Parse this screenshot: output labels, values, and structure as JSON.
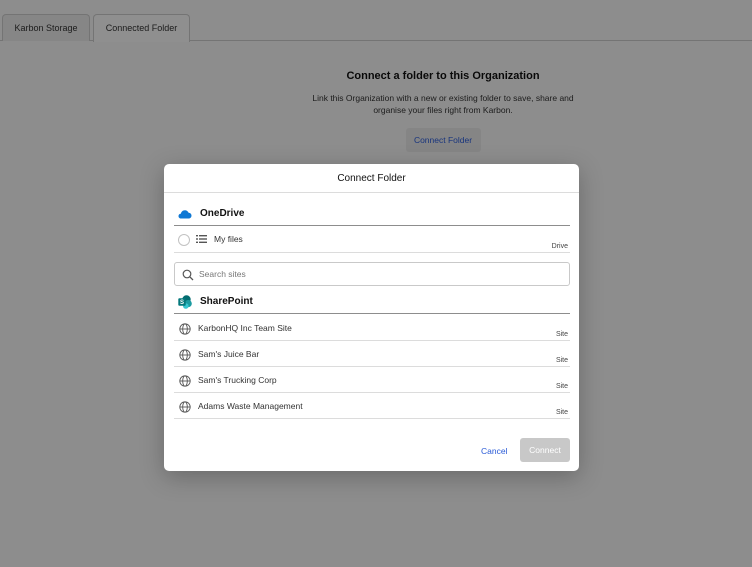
{
  "tabs": [
    {
      "label": "Karbon Storage"
    },
    {
      "label": "Connected Folder"
    }
  ],
  "empty_state": {
    "title": "Connect a folder to this Organization",
    "description_line1": "Link this Organization with a new or existing folder to save, share and",
    "description_line2": "organise your files right from Karbon.",
    "button": "Connect Folder"
  },
  "modal": {
    "title": "Connect Folder",
    "onedrive": {
      "label": "OneDrive",
      "items": [
        {
          "name": "My files",
          "type": "Drive",
          "icon": "list-icon"
        }
      ]
    },
    "search": {
      "placeholder": "Search sites",
      "value": ""
    },
    "sharepoint": {
      "label": "SharePoint",
      "items": [
        {
          "name": "KarbonHQ Inc Team Site",
          "type": "Site",
          "icon": "globe-icon"
        },
        {
          "name": "Sam's Juice Bar",
          "type": "Site",
          "icon": "globe-icon"
        },
        {
          "name": "Sam's Trucking Corp",
          "type": "Site",
          "icon": "globe-icon"
        },
        {
          "name": "Adams Waste Management",
          "type": "Site",
          "icon": "globe-icon"
        }
      ]
    },
    "cancel_label": "Cancel",
    "connect_label": "Connect"
  },
  "colors": {
    "accent": "#2a5bd7",
    "onedrive": "#0f78d4",
    "sharepoint": "#03787c",
    "disabled_button": "#c8c8c8"
  }
}
